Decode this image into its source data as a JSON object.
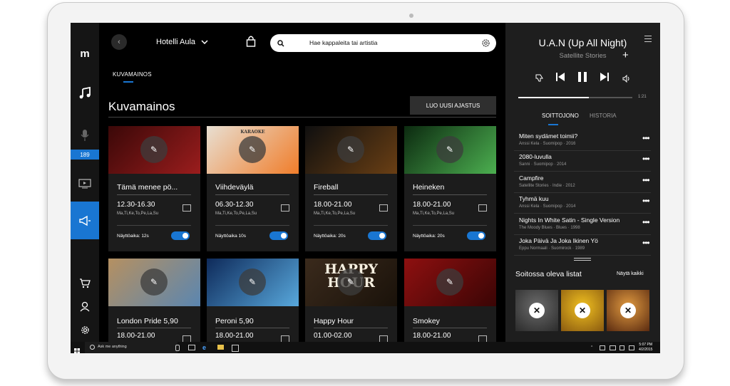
{
  "app": {
    "logo_letter": "m",
    "badge_count": "189"
  },
  "header": {
    "venue": "Hotelli Aula",
    "search_placeholder": "Hae kappaleita tai artistia"
  },
  "section": {
    "tab_label": "KUVAMAINOS",
    "page_title": "Kuvamainos",
    "create_button": "LUO UUSI AJASTUS"
  },
  "cards": [
    {
      "title": "Tämä menee pö...",
      "time": "12.30-16.30",
      "days": "Ma,Ti,Ke,To,Pe,La,Su",
      "duration": "Näyttöaika: 12s",
      "toggle_on": true,
      "image_colors": [
        "#3a0808",
        "#9b1d1d"
      ],
      "icon": "image-icon"
    },
    {
      "title": "Viihdeväylä",
      "time": "06.30-12.30",
      "days": "Ma,Ti,Ke,To,Pe,La,Su",
      "duration": "Näyttöaika 10s",
      "toggle_on": true,
      "image_colors": [
        "#e8dfd2",
        "#f07d2a"
      ],
      "image_text": "KARAOKE",
      "icon": "radio-icon"
    },
    {
      "title": "Fireball",
      "time": "18.00-21.00",
      "days": "Ma,Ti,Ke,To,Pe,La,Su",
      "duration": "Näyttöaika: 20s",
      "toggle_on": true,
      "image_colors": [
        "#0f0f0f",
        "#6a3f14"
      ],
      "icon": "calendar-icon"
    },
    {
      "title": "Heineken",
      "time": "18.00-21.00",
      "days": "Ma,Ti,Ke,To,Pe,La,Su",
      "duration": "Näyttöaika: 20s",
      "toggle_on": true,
      "image_colors": [
        "#0c2a10",
        "#4caf50"
      ],
      "icon": "calendar-icon"
    },
    {
      "title": "London Pride 5,90",
      "time": "18.00-21.00",
      "image_colors": [
        "#b59061",
        "#5b86b0"
      ],
      "icon": "calendar-icon"
    },
    {
      "title": "Peroni 5,90",
      "time": "18.00-21.00",
      "image_colors": [
        "#0e2a5a",
        "#58a8dc"
      ],
      "icon": "calendar-icon"
    },
    {
      "title": "Happy Hour",
      "time": "01.00-02.00",
      "image_colors": [
        "#3a2a1c",
        "#1a120a"
      ],
      "image_text": "HAPPY HOUR",
      "icon": "calendar-icon"
    },
    {
      "title": "Smokey",
      "time": "18.00-21.00",
      "image_colors": [
        "#8e1010",
        "#3a0505"
      ],
      "icon": "calendar-icon"
    }
  ],
  "now_playing": {
    "title": "U.A.N (Up All Night)",
    "artist": "Satellite Stories",
    "progress_fraction": 0.62,
    "time": "1:21"
  },
  "panel_tabs": [
    {
      "label": "SOITTOJONO",
      "active": true
    },
    {
      "label": "HISTORIA",
      "active": false
    }
  ],
  "queue": [
    {
      "title": "Miten sydämet toimii?",
      "meta": "Anssi Kela · Suomipop · 2016"
    },
    {
      "title": "2080-luvulla",
      "meta": "Sanni · Suomipop · 2014"
    },
    {
      "title": "Campfire",
      "meta": "Satellite Stories · Indie · 2012"
    },
    {
      "title": "Tyhmä kuu",
      "meta": "Anssi Kela · Suomipop · 2014"
    },
    {
      "title": "Nights In White Satin - Single Version",
      "meta": "The Moody Blues · Blues · 1998"
    },
    {
      "title": "Joka Päivä Ja Joka Ikinen Yö",
      "meta": "Eppu Normaali · Suomirock · 1989"
    }
  ],
  "playlists": {
    "title": "Soitossa oleva listat",
    "show_all": "Näytä kaikki",
    "remove_symbol": "✕",
    "tiles": [
      {
        "colors": [
          "#6b6b6b",
          "#2b2b2b"
        ]
      },
      {
        "colors": [
          "#f0c020",
          "#8a5a10"
        ]
      },
      {
        "colors": [
          "#e09a40",
          "#5a2a10"
        ]
      }
    ]
  },
  "taskbar": {
    "search_text": "Ask me anything",
    "time": "5:07 PM",
    "date": "4/2/2015"
  },
  "colors": {
    "accent": "#1976d2"
  }
}
